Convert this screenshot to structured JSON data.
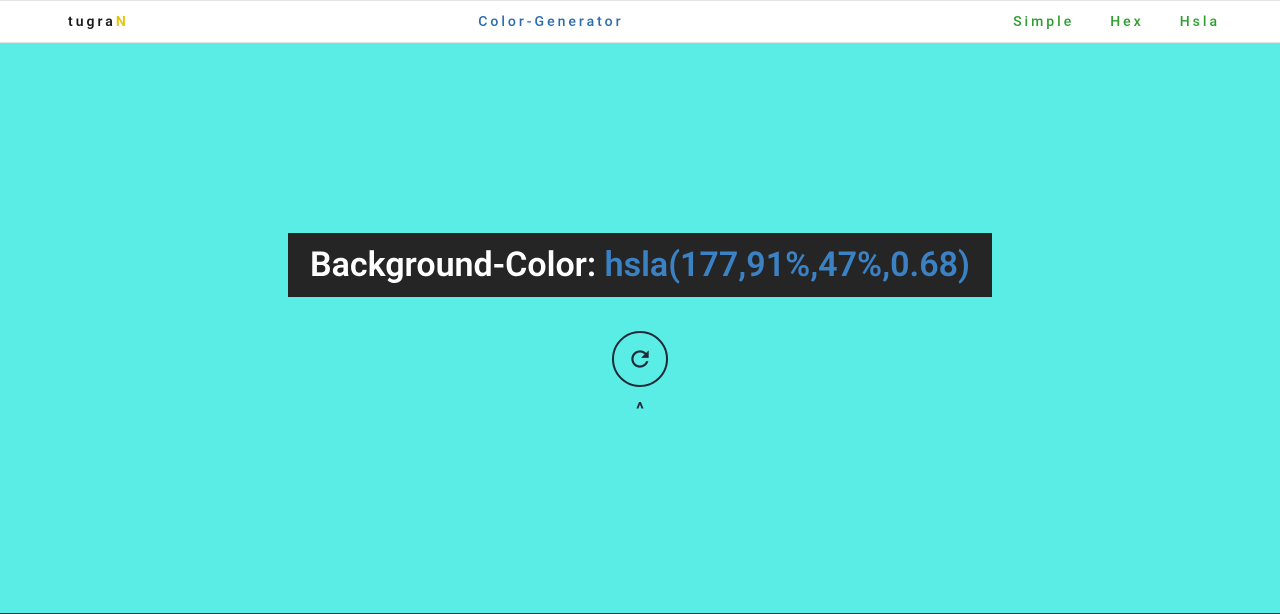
{
  "header": {
    "logo_main": "tugra",
    "logo_accent": "N",
    "title": "Color-Generator",
    "nav": {
      "simple": "Simple",
      "hex": "Hex",
      "hsla": "Hsla"
    }
  },
  "main": {
    "label": "Background-Color: ",
    "color_value": "hsla(177,91%,47%,0.68)",
    "caret": "^"
  },
  "colors": {
    "background": "hsla(177,91%,47%,0.68)"
  }
}
